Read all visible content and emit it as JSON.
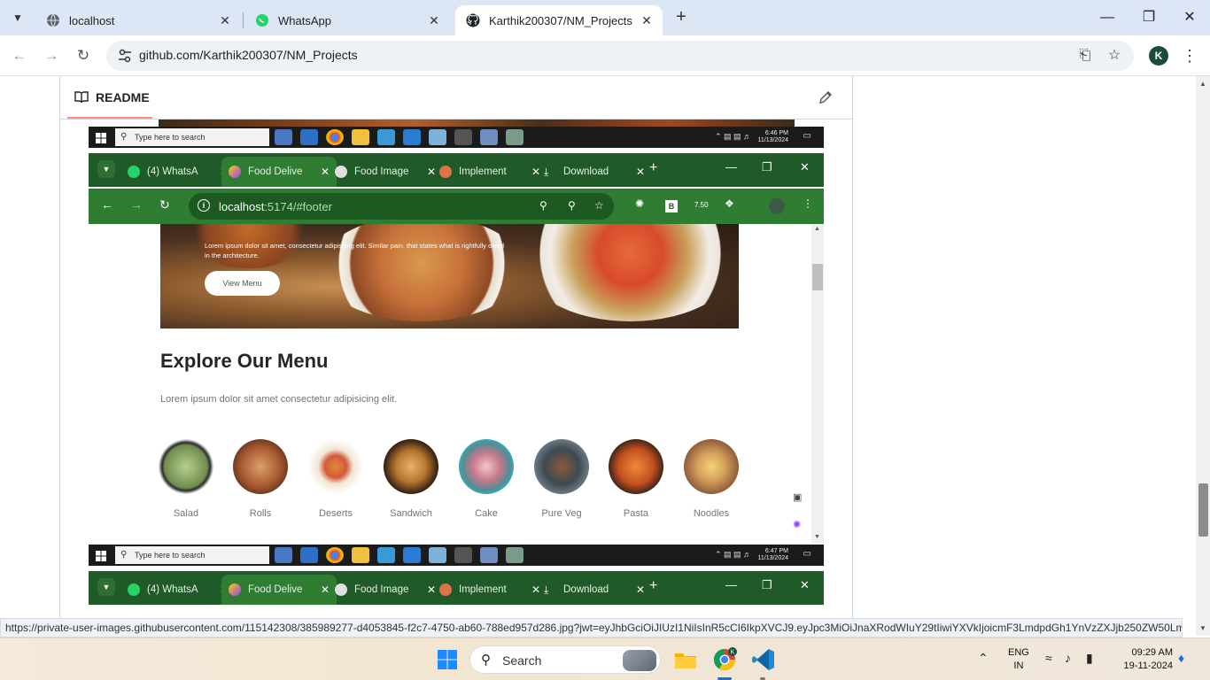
{
  "browser": {
    "tabs": [
      {
        "title": "localhost",
        "icon": "globe-icon",
        "active": false
      },
      {
        "title": "WhatsApp",
        "icon": "whatsapp-icon",
        "active": false
      },
      {
        "title": "Karthik200307/NM_Projects",
        "icon": "github-icon",
        "active": true
      }
    ],
    "url": "github.com/Karthik200307/NM_Projects",
    "profile_initial": "K",
    "status_url": "https://private-user-images.githubusercontent.com/115142308/385989277-d4053845-f2c7-4750-ab60-788ed957d286.jpg?jwt=eyJhbGciOiJIUzI1NiIsInR5cCI6IkpXVCJ9.eyJpc3MiOiJnaXRodWIuY29tIiwiYXVkIjoicmF3LmdpdGh1YnVzZXJjb250ZW50LmN..."
  },
  "readme": {
    "title": "README"
  },
  "screenshot": {
    "win_taskbar": {
      "search_placeholder": "Type here to search",
      "clock1_time": "6:46 PM",
      "clock1_date": "11/13/2024",
      "clock2_time": "6:47 PM",
      "clock2_date": "11/13/2024"
    },
    "tabs": [
      {
        "title": "(4) WhatsA",
        "icon_color": "#25d366"
      },
      {
        "title": "Food Delive",
        "icon_color": "#8e44ff"
      },
      {
        "title": "Food Image",
        "icon_color": "#e0e0e0"
      },
      {
        "title": "Implement",
        "icon_color": "#e0724a"
      },
      {
        "title": "Download",
        "icon_color": "#ffffff"
      }
    ],
    "url_host": "localhost",
    "url_rest": ":5174/#footer",
    "ext_badge": "7.50",
    "hero": {
      "description": "Lorem ipsum dolor sit amet, consectetur adipiscing elit. Similar pain, that states what is rightfully owed in the architecture.",
      "button": "View Menu"
    },
    "menu": {
      "title": "Explore Our Menu",
      "description": "Lorem ipsum dolor sit amet consectetur adipisicing elit.",
      "items": [
        {
          "name": "Salad",
          "color": "#8aa86a"
        },
        {
          "name": "Rolls",
          "color": "#b56a3a"
        },
        {
          "name": "Deserts",
          "color": "#e6d3b8"
        },
        {
          "name": "Sandwich",
          "color": "#6b3c1a"
        },
        {
          "name": "Cake",
          "color": "#c87a8a"
        },
        {
          "name": "Pure Veg",
          "color": "#3e4a52"
        },
        {
          "name": "Pasta",
          "color": "#c4501f"
        },
        {
          "name": "Noodles",
          "color": "#8b5a3a"
        }
      ]
    }
  },
  "taskbar": {
    "search": "Search",
    "lang1": "ENG",
    "lang2": "IN",
    "time": "09:29 AM",
    "date": "19-11-2024"
  }
}
